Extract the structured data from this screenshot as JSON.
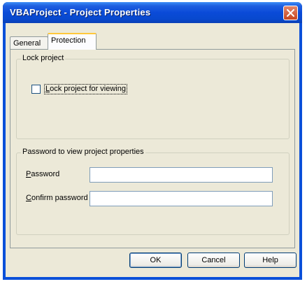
{
  "window": {
    "title": "VBAProject - Project Properties"
  },
  "tabs": [
    {
      "label": "General"
    },
    {
      "label": "Protection"
    }
  ],
  "lock_group": {
    "legend": "Lock project",
    "checkbox_label_mnemonic": "L",
    "checkbox_label_rest": "ock project for viewing",
    "checked": false
  },
  "password_group": {
    "legend": "Password to view project properties",
    "password_label_mnemonic": "P",
    "password_label_rest": "assword",
    "password_value": "",
    "confirm_label_mnemonic": "C",
    "confirm_label_rest": "onfirm password",
    "confirm_value": ""
  },
  "buttons": {
    "ok": "OK",
    "cancel": "Cancel",
    "help": "Help"
  }
}
